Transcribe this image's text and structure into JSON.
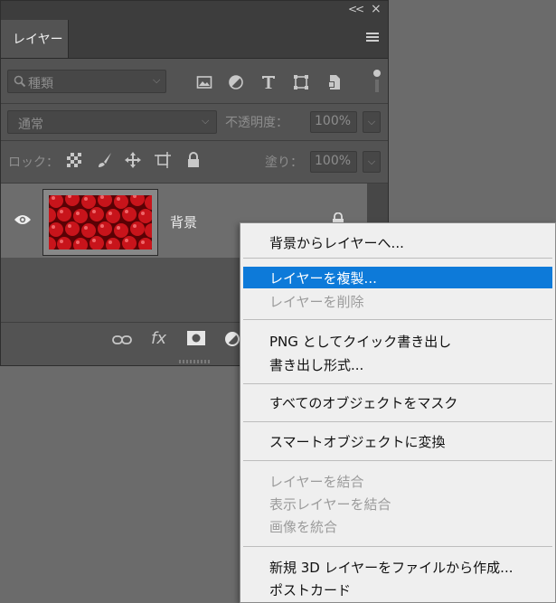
{
  "panel": {
    "collapse_glyph": "<<",
    "close_glyph": "×",
    "tab_label": "レイヤー",
    "menu_icon": "hamburger-menu-icon"
  },
  "filter": {
    "kind_label": "種類",
    "icons": [
      "image-filter-icon",
      "adjustment-filter-icon",
      "type-filter-icon",
      "shape-filter-icon",
      "smart-object-filter-icon"
    ]
  },
  "blend": {
    "mode": "通常",
    "opacity_label": "不透明度：",
    "opacity_value": "100%"
  },
  "lock": {
    "label": "ロック：",
    "icons": [
      "lock-transparent-pixels-icon",
      "lock-image-pixels-icon",
      "lock-position-icon",
      "lock-artboard-icon",
      "lock-all-icon"
    ],
    "fill_label": "塗り：",
    "fill_value": "100%"
  },
  "layer": {
    "name": "背景",
    "visible": true,
    "locked": true
  },
  "bottom_icons": [
    "link-layers-icon",
    "fx-icon",
    "layer-mask-icon",
    "adjustment-layer-icon"
  ],
  "context_menu": {
    "items": [
      {
        "label": "背景からレイヤーへ...",
        "enabled": true
      },
      {
        "label": "レイヤーを複製...",
        "enabled": true,
        "highlighted": true
      },
      {
        "label": "レイヤーを削除",
        "enabled": false
      },
      {
        "label": "PNG としてクイック書き出し",
        "enabled": true
      },
      {
        "label": "書き出し形式...",
        "enabled": true
      },
      {
        "label": "すべてのオブジェクトをマスク",
        "enabled": true
      },
      {
        "label": "スマートオブジェクトに変換",
        "enabled": true
      },
      {
        "label": "レイヤーを結合",
        "enabled": false
      },
      {
        "label": "表示レイヤーを結合",
        "enabled": false
      },
      {
        "label": "画像を統合",
        "enabled": false
      },
      {
        "label": "新規 3D レイヤーをファイルから作成...",
        "enabled": true
      },
      {
        "label": "ポストカード",
        "enabled": true
      }
    ],
    "highlight_color": "#0d7ad9"
  }
}
